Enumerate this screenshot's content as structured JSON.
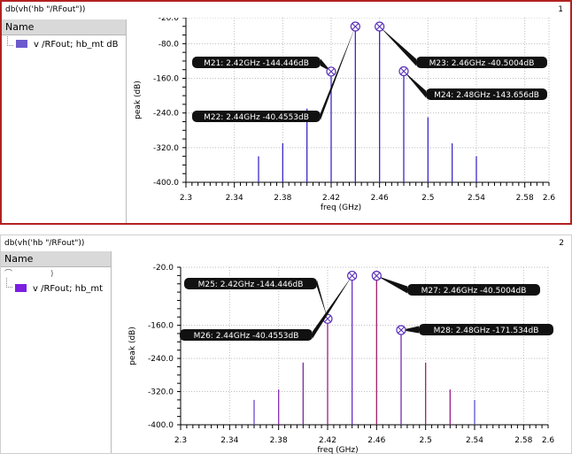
{
  "panels": [
    {
      "title": "db(vh('hb \"/RFout\"))",
      "number": "1",
      "sidebar_header": "Name",
      "legend_label": "v /RFout; hb_mt dB",
      "legend_color": "#6a5acd"
    },
    {
      "title": "db(vh('hb \"/RFout\"))",
      "number": "2",
      "sidebar_header": "Name",
      "legend_label": "v /RFout; hb_mt",
      "legend_color": "#7b1fe0"
    }
  ],
  "chart_data": [
    {
      "type": "bar",
      "style": "stem",
      "xlabel": "freq (GHz)",
      "ylabel": "peak (dB)",
      "xlim": [
        2.3,
        2.6
      ],
      "ylim": [
        -400,
        -20
      ],
      "xticks": [
        "2.3",
        "2.34",
        "2.38",
        "2.42",
        "2.46",
        "2.5",
        "2.54",
        "2.58",
        "2.6"
      ],
      "yticks": [
        "-20.0",
        "-80.0",
        "-160.0",
        "-240.0",
        "-320.0",
        "-400.0"
      ],
      "grid": true,
      "stem_color": "#3a28c8",
      "x": [
        2.36,
        2.38,
        2.4,
        2.42,
        2.44,
        2.46,
        2.48,
        2.5,
        2.52,
        2.54
      ],
      "values": [
        -340,
        -310,
        -230,
        -144.446,
        -40.4553,
        -40.5004,
        -143.656,
        -250,
        -310,
        -340
      ],
      "markers": [
        {
          "name": "M21",
          "x": 2.42,
          "y": -144.446,
          "label": "M21: 2.42GHz -144.446dB"
        },
        {
          "name": "M22",
          "x": 2.44,
          "y": -40.4553,
          "label": "M22: 2.44GHz -40.4553dB"
        },
        {
          "name": "M23",
          "x": 2.46,
          "y": -40.5004,
          "label": "M23: 2.46GHz -40.5004dB"
        },
        {
          "name": "M24",
          "x": 2.48,
          "y": -143.656,
          "label": "M24: 2.48GHz -143.656dB"
        }
      ]
    },
    {
      "type": "bar",
      "style": "stem",
      "xlabel": "freq (GHz)",
      "ylabel": "peak (dB)",
      "xlim": [
        2.3,
        2.6
      ],
      "ylim": [
        -400,
        -20
      ],
      "xticks": [
        "2.3",
        "2.34",
        "2.38",
        "2.42",
        "2.46",
        "2.5",
        "2.54",
        "2.58",
        "2.6"
      ],
      "yticks": [
        "-20.0",
        "-160.0",
        "-240.0",
        "-320.0",
        "-400.0"
      ],
      "grid": true,
      "stem_colors": [
        "#6a4cd6",
        "#8a2fb8",
        "#7b2aa0",
        "#9b1f86",
        "#6a2ec8",
        "#a0226a",
        "#7a2ab0",
        "#a0226a",
        "#9b1f86",
        "#5a52d4"
      ],
      "x": [
        2.36,
        2.38,
        2.4,
        2.42,
        2.44,
        2.46,
        2.48,
        2.5,
        2.52,
        2.54
      ],
      "values": [
        -340,
        -315,
        -250,
        -144.446,
        -40.4553,
        -40.5004,
        -171.534,
        -250,
        -315,
        -340
      ],
      "markers": [
        {
          "name": "M25",
          "x": 2.42,
          "y": -144.446,
          "label": "M25: 2.42GHz -144.446dB"
        },
        {
          "name": "M26",
          "x": 2.44,
          "y": -40.4553,
          "label": "M26: 2.44GHz -40.4553dB"
        },
        {
          "name": "M27",
          "x": 2.46,
          "y": -40.5004,
          "label": "M27: 2.46GHz -40.5004dB"
        },
        {
          "name": "M28",
          "x": 2.48,
          "y": -171.534,
          "label": "M28: 2.48GHz -171.534dB"
        }
      ]
    }
  ]
}
